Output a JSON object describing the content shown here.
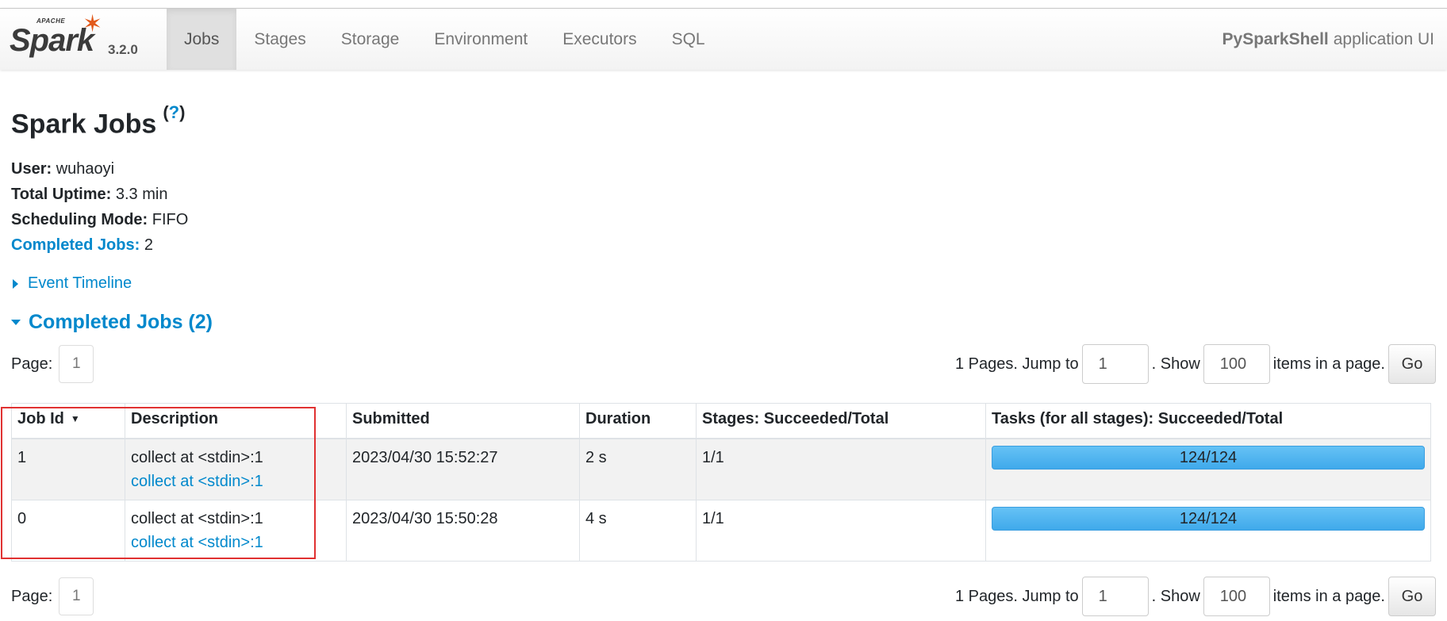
{
  "brand": {
    "apache": "APACHE",
    "name": "Spark",
    "version": "3.2.0"
  },
  "nav": {
    "tabs": [
      "Jobs",
      "Stages",
      "Storage",
      "Environment",
      "Executors",
      "SQL"
    ],
    "active": "Jobs",
    "app_name": "PySparkShell",
    "app_suffix": "application UI"
  },
  "page": {
    "title": "Spark Jobs",
    "help": "?",
    "summary": {
      "user_label": "User:",
      "user": "wuhaoyi",
      "uptime_label": "Total Uptime:",
      "uptime": "3.3 min",
      "mode_label": "Scheduling Mode:",
      "mode": "FIFO",
      "completed_label": "Completed Jobs:",
      "completed": "2"
    },
    "event_timeline": "Event Timeline",
    "completed_header": "Completed Jobs (2)"
  },
  "pager": {
    "page_label": "Page:",
    "current_page": "1",
    "pages_text": "1 Pages. Jump to",
    "jump_value": "1",
    "show_text": ". Show",
    "show_value": "100",
    "items_text": "items in a page.",
    "go_label": "Go"
  },
  "table": {
    "headers": [
      "Job Id",
      "Description",
      "Submitted",
      "Duration",
      "Stages: Succeeded/Total",
      "Tasks (for all stages): Succeeded/Total"
    ],
    "sort_indicator": "▼",
    "rows": [
      {
        "id": "1",
        "desc": "collect at <stdin>:1",
        "desc_link": "collect at <stdin>:1",
        "submitted": "2023/04/30 15:52:27",
        "duration": "2 s",
        "stages": "1/1",
        "tasks": "124/124",
        "tasks_fraction": 1.0
      },
      {
        "id": "0",
        "desc": "collect at <stdin>:1",
        "desc_link": "collect at <stdin>:1",
        "submitted": "2023/04/30 15:50:28",
        "duration": "4 s",
        "stages": "1/1",
        "tasks": "124/124",
        "tasks_fraction": 1.0
      }
    ]
  },
  "colors": {
    "link": "#0088cc",
    "progress": "#4bb1f0",
    "highlight": "#e03131",
    "spark_orange": "#e25a1c"
  }
}
